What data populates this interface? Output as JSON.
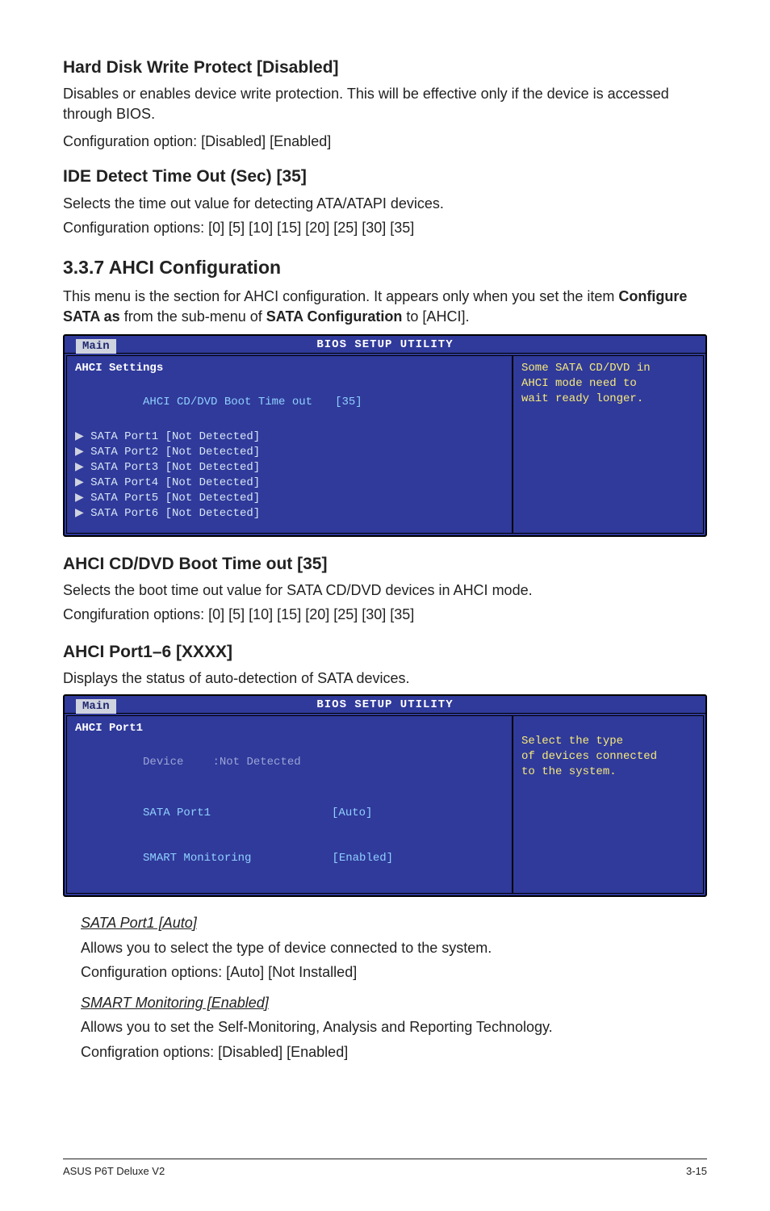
{
  "s1": {
    "h": "Hard Disk Write Protect [Disabled]",
    "p1": "Disables or enables device write protection. This will be effective only if the device is accessed through BIOS.",
    "p2": "Configuration option: [Disabled] [Enabled]"
  },
  "s2": {
    "h": "IDE Detect Time Out (Sec) [35]",
    "p1": "Selects the time out value for detecting ATA/ATAPI devices.",
    "p2": "Configuration options: [0] [5] [10] [15] [20] [25] [30] [35]"
  },
  "s3": {
    "num_title": "3.3.7      AHCI Configuration",
    "p1": "This menu is the section for AHCI configuration. It appears only when you set the item ",
    "bold1": "Configure SATA as",
    "mid": " from the sub-menu of ",
    "bold2": "SATA Configuration",
    "tail": " to [AHCI]."
  },
  "bios1": {
    "title": "BIOS SETUP UTILITY",
    "tab": "Main",
    "settings_label": "AHCI Settings",
    "boot_time_label": "AHCI CD/DVD Boot Time out",
    "boot_time_val": "[35]",
    "items": [
      "SATA Port1 [Not Detected]",
      "SATA Port2 [Not Detected]",
      "SATA Port3 [Not Detected]",
      "SATA Port4 [Not Detected]",
      "SATA Port5 [Not Detected]",
      "SATA Port6 [Not Detected]"
    ],
    "help1": "Some SATA CD/DVD in",
    "help2": "AHCI mode need to",
    "help3": "wait ready longer."
  },
  "s4": {
    "h": "AHCI CD/DVD Boot Time out [35]",
    "p1": "Selects the boot time out value for SATA CD/DVD devices in AHCI mode.",
    "p2": "Congifuration options: [0] [5] [10] [15] [20] [25] [30] [35]"
  },
  "s5": {
    "h": "AHCI Port1–6 [XXXX]",
    "p1": "Displays the status of auto-detection of SATA devices."
  },
  "bios2": {
    "title": "BIOS SETUP UTILITY",
    "tab": "Main",
    "header": "AHCI Port1",
    "dev_label": "Device",
    "dev_val": ":Not Detected",
    "sp_label": "SATA Port1",
    "sp_val": "[Auto]",
    "sm_label": "SMART Monitoring",
    "sm_val": "[Enabled]",
    "help1": "Select the type",
    "help2": "of devices connected",
    "help3": "to the system."
  },
  "sp": {
    "h": "SATA Port1 [Auto]",
    "p1": "Allows you to select the type of device connected to the system.",
    "p2": "Configuration options: [Auto] [Not Installed]"
  },
  "sm": {
    "h": "SMART Monitoring [Enabled]",
    "p1": "Allows you to set the Self-Monitoring, Analysis and Reporting Technology.",
    "p2": "Configration options: [Disabled] [Enabled]"
  },
  "footer": {
    "left": "ASUS P6T Deluxe V2",
    "right": "3-15"
  }
}
